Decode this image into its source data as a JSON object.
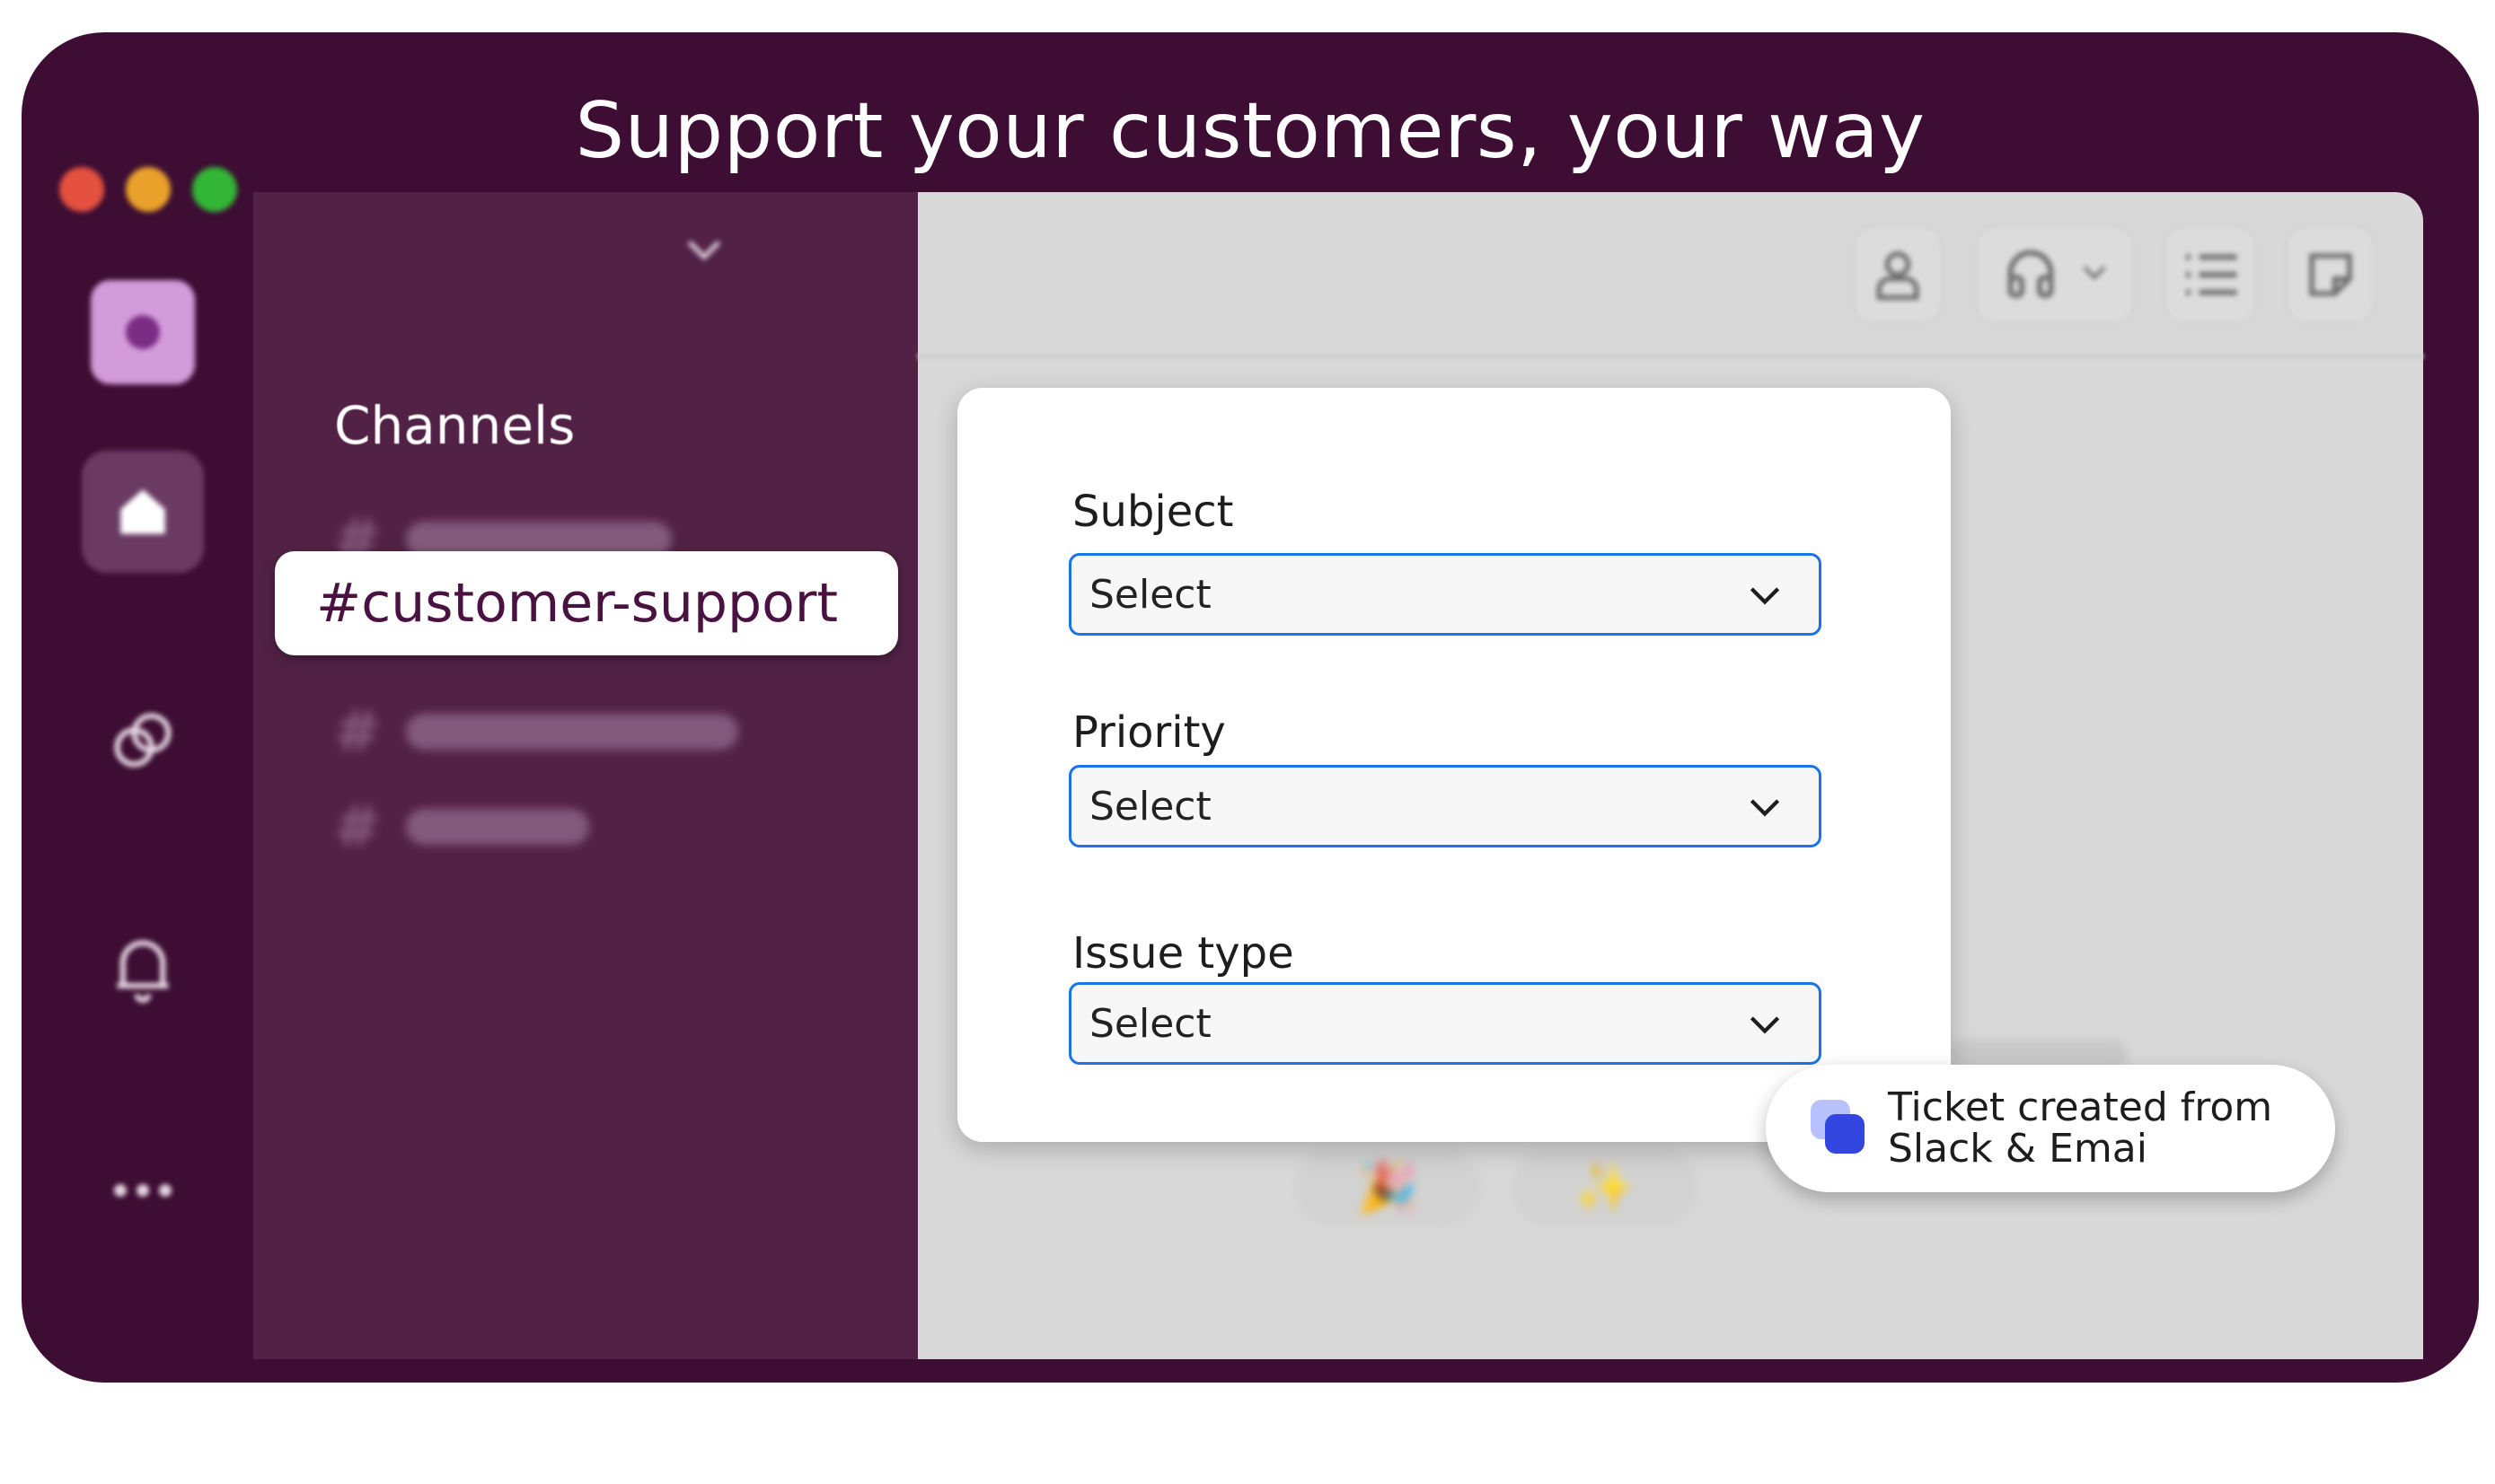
{
  "headline": "Support your customers, your way",
  "window_controls": {
    "colors": [
      "#e4513f",
      "#e9a12b",
      "#33b535"
    ]
  },
  "rail": {
    "items": [
      "workspace-avatar",
      "home-icon",
      "dms-icon",
      "bell-icon",
      "more-icon"
    ]
  },
  "sidebar": {
    "section_label": "Channels",
    "selected_channel": "#customer-support"
  },
  "toolbar": {
    "icons": [
      "user-icon",
      "headphones-icon",
      "chevron-down-icon",
      "list-icon",
      "notes-icon"
    ]
  },
  "form": {
    "fields": [
      {
        "label": "Subject",
        "value": "Select"
      },
      {
        "label": "Priority",
        "value": "Select"
      },
      {
        "label": "Issue type",
        "value": "Select"
      }
    ]
  },
  "toast": {
    "line1": "Ticket created from",
    "line2": "Slack & Emai"
  },
  "colors": {
    "frame": "#3d0d33",
    "sidebar": "#522246",
    "accent_border": "#1a73e8",
    "selected_text": "#4a1240"
  }
}
